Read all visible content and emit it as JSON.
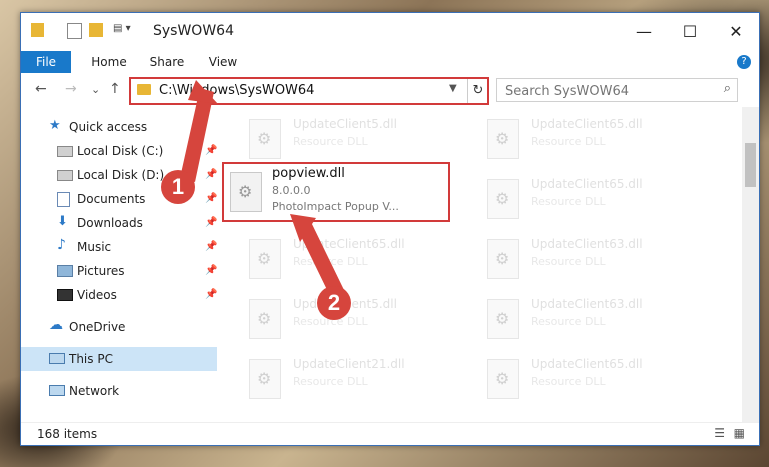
{
  "window": {
    "title": "SysWOW64",
    "controls": {
      "minimize": "—",
      "maximize": "☐",
      "close": "✕"
    }
  },
  "ribbon": {
    "tabs": [
      "File",
      "Home",
      "Share",
      "View"
    ],
    "help": "?"
  },
  "nav": {
    "back": "←",
    "forward": "→",
    "recent": "⌄",
    "up": "↑"
  },
  "address": {
    "path": "C:\\Windows\\SysWOW64",
    "refresh": "↻"
  },
  "search": {
    "placeholder": "Search SysWOW64"
  },
  "sidebar": {
    "items": [
      {
        "label": "Quick access",
        "icon": "star-icon"
      },
      {
        "label": "Local Disk (C:)",
        "icon": "drive-icon",
        "pinned": true
      },
      {
        "label": "Local Disk (D:)",
        "icon": "drive-icon",
        "pinned": true
      },
      {
        "label": "Documents",
        "icon": "documents-icon",
        "pinned": true
      },
      {
        "label": "Downloads",
        "icon": "download-icon",
        "pinned": true
      },
      {
        "label": "Music",
        "icon": "music-icon",
        "pinned": true
      },
      {
        "label": "Pictures",
        "icon": "pictures-icon",
        "pinned": true
      },
      {
        "label": "Videos",
        "icon": "videos-icon",
        "pinned": true
      },
      {
        "label": "OneDrive",
        "icon": "cloud-icon"
      },
      {
        "label": "This PC",
        "icon": "computer-icon",
        "selected": true
      },
      {
        "label": "Network",
        "icon": "network-icon"
      }
    ]
  },
  "files": {
    "left": [
      {
        "name": "UpdateClient5.dll",
        "desc": "Resource DLL"
      },
      {
        "name": "popview.dll",
        "desc": "8.0.0.0",
        "desc2": "PhotoImpact Popup V..."
      },
      {
        "name": "UpdateClient65.dll",
        "desc": "Resource DLL"
      },
      {
        "name": "UpdateClient5.dll",
        "desc": "Resource DLL"
      },
      {
        "name": "UpdateClient21.dll",
        "desc": "Resource DLL"
      }
    ],
    "right": [
      {
        "name": "UpdateClient65.dll",
        "desc": "Resource DLL"
      },
      {
        "name": "UpdateClient65.dll",
        "desc": "Resource DLL"
      },
      {
        "name": "UpdateClient63.dll",
        "desc": "Resource DLL"
      },
      {
        "name": "UpdateClient63.dll",
        "desc": "Resource DLL"
      },
      {
        "name": "UpdateClient65.dll",
        "desc": "Resource DLL"
      }
    ]
  },
  "status": {
    "count": "168 items"
  },
  "annotations": {
    "step1": "1",
    "step2": "2",
    "color": "#d6453d"
  }
}
